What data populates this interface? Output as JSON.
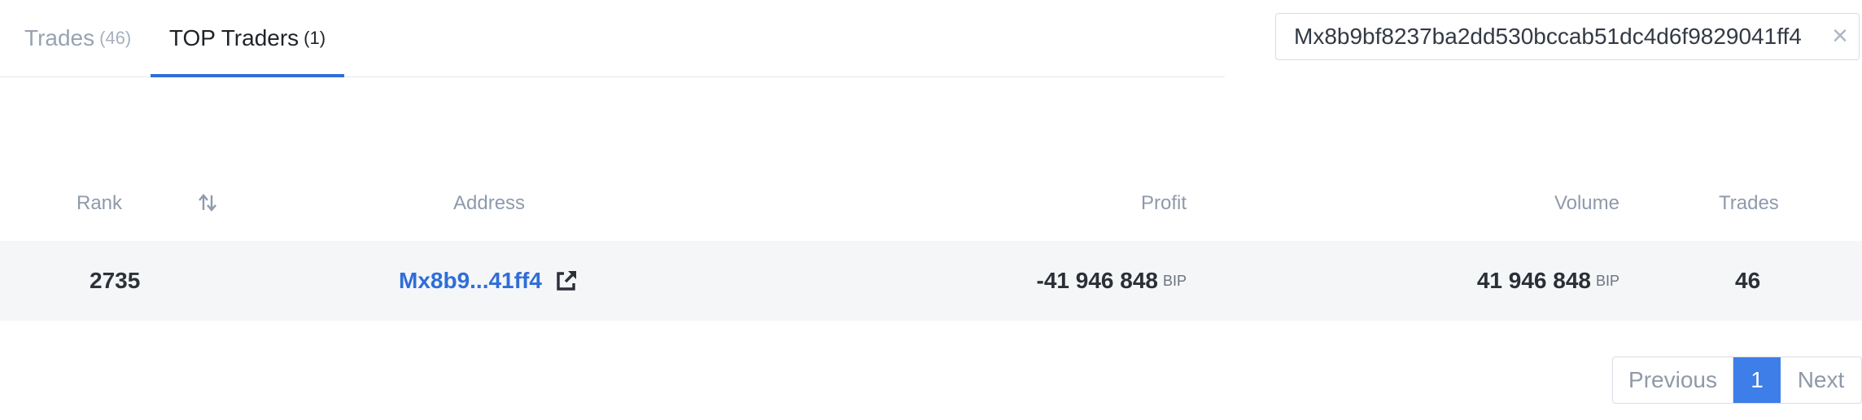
{
  "tabs": {
    "trades": {
      "label": "Trades",
      "count": "(46)"
    },
    "top_traders": {
      "label": "TOP Traders",
      "count": "(1)"
    }
  },
  "search": {
    "value": "Mx8b9bf8237ba2dd530bccab51dc4d6f9829041ff4",
    "clear_icon": "close-icon"
  },
  "table": {
    "headers": {
      "rank": "Rank",
      "address": "Address",
      "profit": "Profit",
      "volume": "Volume",
      "trades": "Trades"
    },
    "rows": [
      {
        "rank": "2735",
        "address": "Mx8b9...41ff4",
        "profit": "-41 946 848",
        "profit_unit": "BIP",
        "volume": "41 946 848",
        "volume_unit": "BIP",
        "trades": "46"
      }
    ]
  },
  "pagination": {
    "previous": "Previous",
    "current": "1",
    "next": "Next"
  },
  "colors": {
    "accent": "#2f6ed8",
    "active_page": "#3d7ee8",
    "row_bg": "#f5f6f8"
  }
}
